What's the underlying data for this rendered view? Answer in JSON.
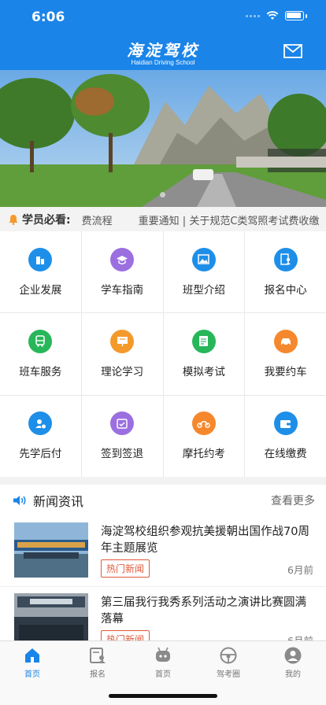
{
  "status_bar": {
    "time": "6:06"
  },
  "header": {
    "logo_cn": "海淀驾校",
    "logo_en": "Haidian Driving School",
    "mail_icon": "mail-icon"
  },
  "notice": {
    "label": "学员必看:",
    "text": "费流程        重要通知 | 关于规范C类驾照考试费收缴",
    "icon": "bell-icon"
  },
  "menu": [
    {
      "label": "企业发展",
      "icon": "building-icon",
      "color": "#1e8fe8"
    },
    {
      "label": "学车指南",
      "icon": "graduation-cap-icon",
      "color": "#9b6fe0"
    },
    {
      "label": "班型介绍",
      "icon": "image-icon",
      "color": "#1e8fe8"
    },
    {
      "label": "报名中心",
      "icon": "user-form-icon",
      "color": "#1e8fe8"
    },
    {
      "label": "班车服务",
      "icon": "bus-icon",
      "color": "#28b65a"
    },
    {
      "label": "理论学习",
      "icon": "board-icon",
      "color": "#f39a2b"
    },
    {
      "label": "模拟考试",
      "icon": "exam-sheet-icon",
      "color": "#28b65a"
    },
    {
      "label": "我要约车",
      "icon": "car-icon",
      "color": "#f5882c"
    },
    {
      "label": "先学后付",
      "icon": "user-pay-icon",
      "color": "#1e8fe8"
    },
    {
      "label": "签到签退",
      "icon": "calendar-check-icon",
      "color": "#9b6fe0"
    },
    {
      "label": "摩托约考",
      "icon": "motorcycle-icon",
      "color": "#f5882c"
    },
    {
      "label": "在线缴费",
      "icon": "wallet-icon",
      "color": "#1e8fe8"
    }
  ],
  "news": {
    "title": "新闻资讯",
    "more": "查看更多",
    "icon": "speaker-icon",
    "items": [
      {
        "headline": "海淀驾校组织参观抗美援朝出国作战70周年主题展览",
        "tag": "热门新闻",
        "time": "6月前"
      },
      {
        "headline": "第三届我行我秀系列活动之演讲比赛圆满落幕",
        "tag": "热门新闻",
        "time": "6月前"
      }
    ]
  },
  "tabbar": [
    {
      "label": "首页",
      "icon": "home-icon",
      "active": true
    },
    {
      "label": "报名",
      "icon": "register-icon",
      "active": false
    },
    {
      "label": "首页",
      "icon": "robot-icon",
      "active": false
    },
    {
      "label": "驾考圈",
      "icon": "steering-wheel-icon",
      "active": false
    },
    {
      "label": "我的",
      "icon": "profile-icon",
      "active": false
    }
  ],
  "colors": {
    "brand": "#1a84e8",
    "tag": "#e05a3a"
  }
}
